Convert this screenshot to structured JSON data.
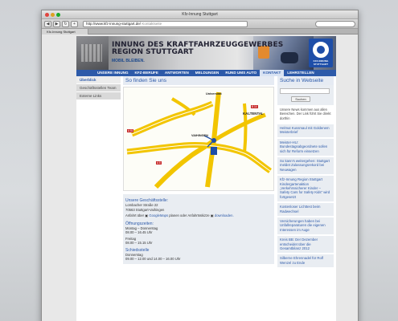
{
  "browser": {
    "window_title": "Kfz-Innung Stuttgart",
    "url": "http://www.kfz-innung-stuttgart.de/",
    "url_page_title": "Kontaktseite",
    "tab_label": "Kfz-Innung Stuttgart"
  },
  "header": {
    "title_line1": "INNUNG DES KRAFTFAHRZEUGGEWERBES",
    "title_line2": "REGION STUTTGART",
    "slogan": "MOBIL BLEIBEN.",
    "logo_text": "KFZ-INNUNG STUTTGART"
  },
  "nav": {
    "items": [
      "UNSERE INNUNG",
      "KFZ-BERUFE",
      "ANTWORTEN",
      "MELDUNGEN",
      "RUND UMS AUTO",
      "KONTAKT",
      "LEHRSTELLEN"
    ],
    "active": "KONTAKT"
  },
  "sidebar": {
    "items": [
      "Überblick",
      "Geschäftsstellen Team",
      "Externe Links"
    ]
  },
  "main": {
    "title": "So finden Sie uns",
    "map_labels": {
      "universitaet": "Universität",
      "kaltental": "KALTENTAL",
      "vaihingen": "VAIHINGEN"
    },
    "address_heading": "Unsere Geschäftsstelle:",
    "address_street": "Lombacher Straße 22",
    "address_city": "70563 Stuttgart-Vaihingen",
    "anfahrt_prefix": "Anfahrt über",
    "anfahrt_link1": "GoogleMaps",
    "anfahrt_mid": "planen oder Anfahrtsskizze",
    "anfahrt_link2": "downloaden.",
    "hours_heading": "Öffnungszeiten:",
    "hours_1_days": "Montag – Donnerstag",
    "hours_1_time": "08.00 – 16.45 Uhr",
    "hours_2_days": "Freitag",
    "hours_2_time": "08.00 – 15.15 Uhr",
    "school_heading": "Schiedsstelle",
    "school_days": "Donnerstag",
    "school_time": "09.00 – 12.00 und 14.00 – 16.00 Uhr"
  },
  "right": {
    "search_title": "Suche in Webseite",
    "search_button": "Suchen",
    "note": "Unsere News kommen aus allen Bereichen. Der Link führt Sie direkt dorthin",
    "news": [
      "Helmut Kussmaul mit Goldenem Meisterbrief",
      "Meister-HU: Bundestagsabgeordnete sollen sich für Reform einsetzen",
      "So kann's weitergehen: Stuttgart meldet Zulassungsrekord bei Neuwagen",
      "Kfz-Innung Region Stuttgart Kindergartenaktion „Verkehrssicherer Kinder – Safety Cars for Safety Kids\" wird fortgesetzt",
      "Kostenloser Lichttest beim Radwechsel",
      "Versicherungen haben bei Unfallreparaturen die eigenen Interessen im Auge",
      "Kreis BB: Der Dezember entscheidet über die Gesamtbilanz 2012",
      "Silberne Ehrennadel für Rolf Wenzel zu Ende"
    ]
  }
}
